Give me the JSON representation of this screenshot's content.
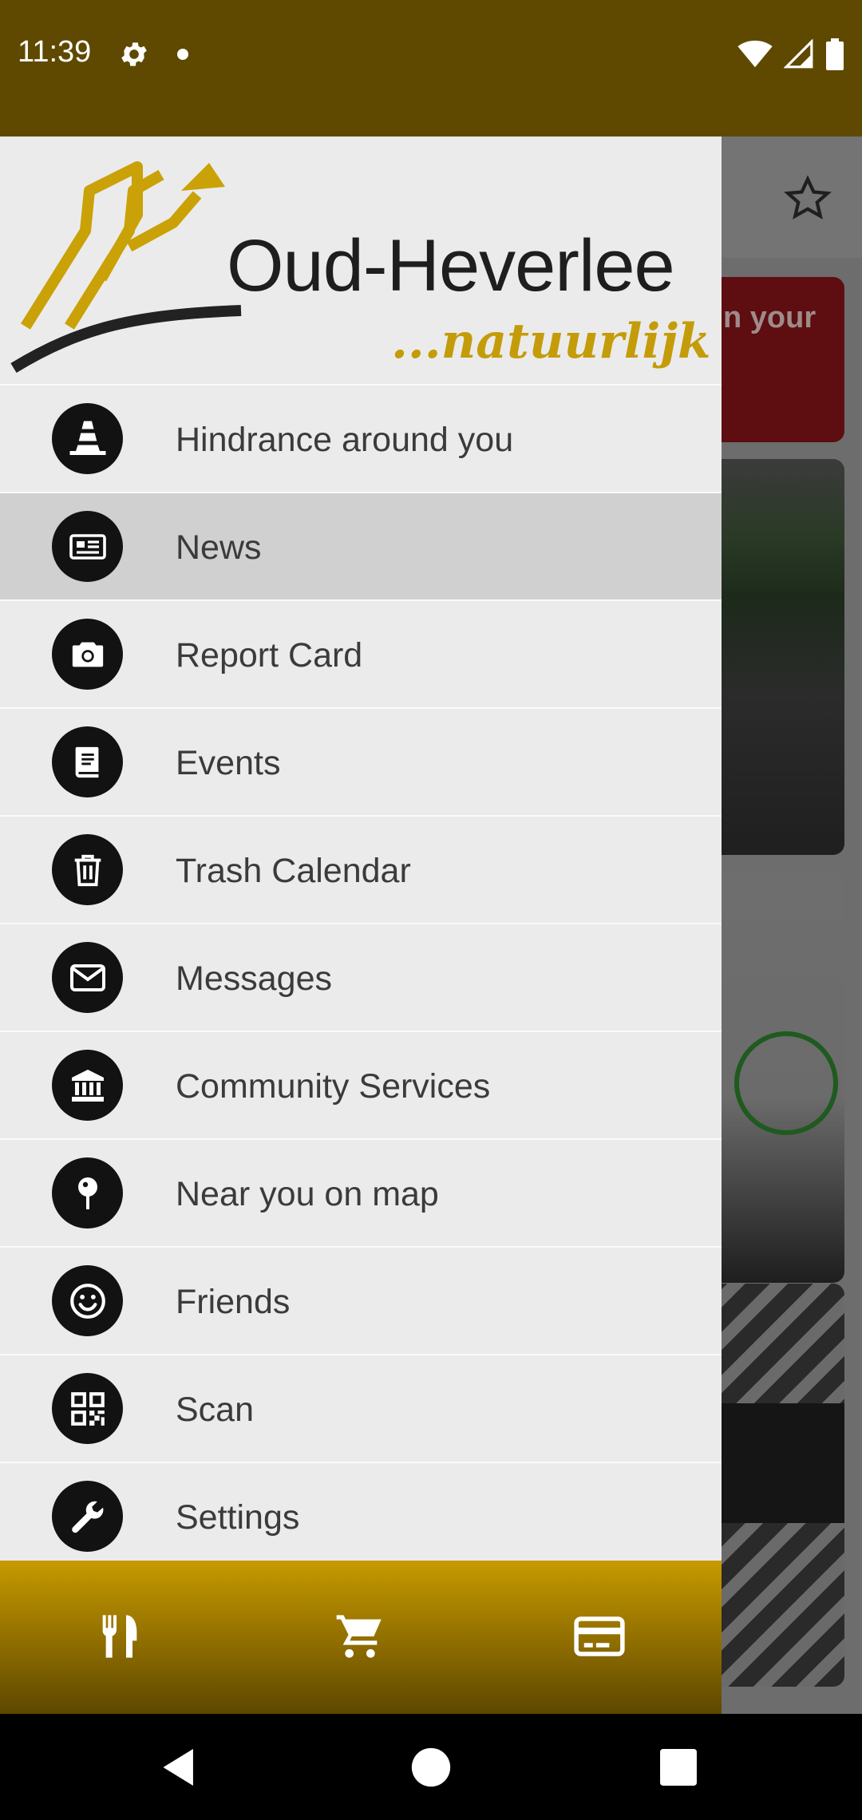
{
  "status_bar": {
    "time": "11:39",
    "icons": [
      "settings-gear-icon",
      "notification-dot-icon",
      "wifi-icon",
      "cell-signal-icon",
      "battery-icon"
    ]
  },
  "background": {
    "card_text": "n your",
    "icons": [
      "star-outline-icon"
    ]
  },
  "drawer": {
    "logo": {
      "title": "Oud-Heverlee",
      "slogan": "...natuurlijk !"
    },
    "menu": [
      {
        "label": "Hindrance around you",
        "icon": "traffic-cone-icon",
        "active": false
      },
      {
        "label": "News",
        "icon": "newspaper-icon",
        "active": true
      },
      {
        "label": "Report Card",
        "icon": "camera-icon",
        "active": false
      },
      {
        "label": "Events",
        "icon": "book-icon",
        "active": false
      },
      {
        "label": "Trash Calendar",
        "icon": "trash-can-icon",
        "active": false
      },
      {
        "label": "Messages",
        "icon": "envelope-icon",
        "active": false
      },
      {
        "label": "Community Services",
        "icon": "bank-building-icon",
        "active": false
      },
      {
        "label": "Near you on map",
        "icon": "map-pin-icon",
        "active": false
      },
      {
        "label": "Friends",
        "icon": "smiley-icon",
        "active": false
      },
      {
        "label": "Scan",
        "icon": "qr-code-icon",
        "active": false
      },
      {
        "label": "Settings",
        "icon": "wrench-icon",
        "active": false
      }
    ],
    "footer_icons": [
      "fork-knife-icon",
      "shopping-cart-icon",
      "payment-card-icon"
    ],
    "colors": {
      "drawer_bg": "#ebebeb",
      "active_item_bg": "#d0d0d0",
      "footer_gradient_top": "#c79a00",
      "footer_gradient_bottom": "#5e4700",
      "brand_gold": "#c49c0a",
      "status_bar": "#5f4900"
    }
  },
  "nav_bar": {
    "icons": [
      "back-triangle-icon",
      "home-circle-icon",
      "recents-square-icon"
    ]
  }
}
